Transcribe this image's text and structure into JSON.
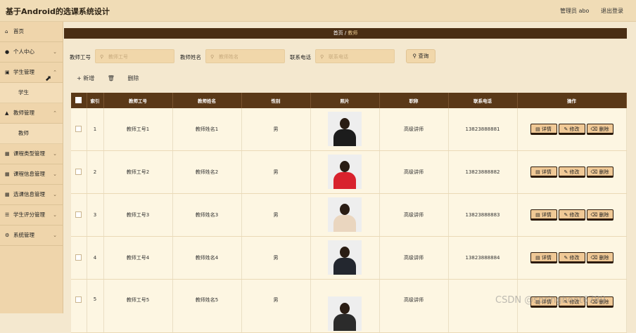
{
  "app": {
    "title": "基于Android的选课系统设计"
  },
  "header": {
    "user": "管理员 abo",
    "logout": "退出登录"
  },
  "sidebar": {
    "items": [
      {
        "icon": "home-icon",
        "label": "首页",
        "chevron": false
      },
      {
        "icon": "user-icon",
        "label": "个人中心",
        "chevron": true
      },
      {
        "icon": "briefcase-icon",
        "label": "学生管理",
        "chevron": true
      },
      {
        "icon": "sub",
        "label": "学生"
      },
      {
        "icon": "teacher-icon",
        "label": "教师管理",
        "chevron": true
      },
      {
        "icon": "sub",
        "label": "教师"
      },
      {
        "icon": "grid-icon",
        "label": "课程类型管理",
        "chevron": true
      },
      {
        "icon": "grid-icon",
        "label": "课程信息管理",
        "chevron": true
      },
      {
        "icon": "grid-icon",
        "label": "选课信息管理",
        "chevron": true
      },
      {
        "icon": "list-icon",
        "label": "学生评分管理",
        "chevron": true
      },
      {
        "icon": "gear-icon",
        "label": "系统管理",
        "chevron": true
      }
    ]
  },
  "breadcrumb": {
    "home": "首页",
    "sep": "/",
    "current": "教师"
  },
  "search": {
    "field1_label": "教师工号",
    "field1_placeholder": "教师工号",
    "field2_label": "教师姓名",
    "field2_placeholder": "教师姓名",
    "field3_label": "联系电话",
    "field3_placeholder": "联系电话",
    "button": "查询"
  },
  "actions": {
    "add": "+ 新增",
    "delete": "删除"
  },
  "table": {
    "headers": [
      "",
      "索引",
      "教师工号",
      "教师姓名",
      "性别",
      "照片",
      "职称",
      "联系电话",
      "操作"
    ],
    "rows": [
      {
        "index": "1",
        "id": "教师工号1",
        "name": "教师姓名1",
        "gender": "男",
        "title": "高级讲师",
        "phone": "13823888881",
        "photo_color": "#1c1c1c"
      },
      {
        "index": "2",
        "id": "教师工号2",
        "name": "教师姓名2",
        "gender": "男",
        "title": "高级讲师",
        "phone": "13823888882",
        "photo_color": "#d8222d"
      },
      {
        "index": "3",
        "id": "教师工号3",
        "name": "教师姓名3",
        "gender": "男",
        "title": "高级讲师",
        "phone": "13823888883",
        "photo_color": "#ead6bf"
      },
      {
        "index": "4",
        "id": "教师工号4",
        "name": "教师姓名4",
        "gender": "男",
        "title": "高级讲师",
        "phone": "13823888884",
        "photo_color": "#23272f"
      },
      {
        "index": "5",
        "id": "教师工号5",
        "name": "教师姓名5",
        "gender": "男",
        "title": "高级讲师",
        "phone": "",
        "photo_color": "#2b2b2b"
      }
    ],
    "op_detail": "详情",
    "op_edit": "修改",
    "op_delete": "删除"
  },
  "watermark": "CSDN @springboot6789"
}
